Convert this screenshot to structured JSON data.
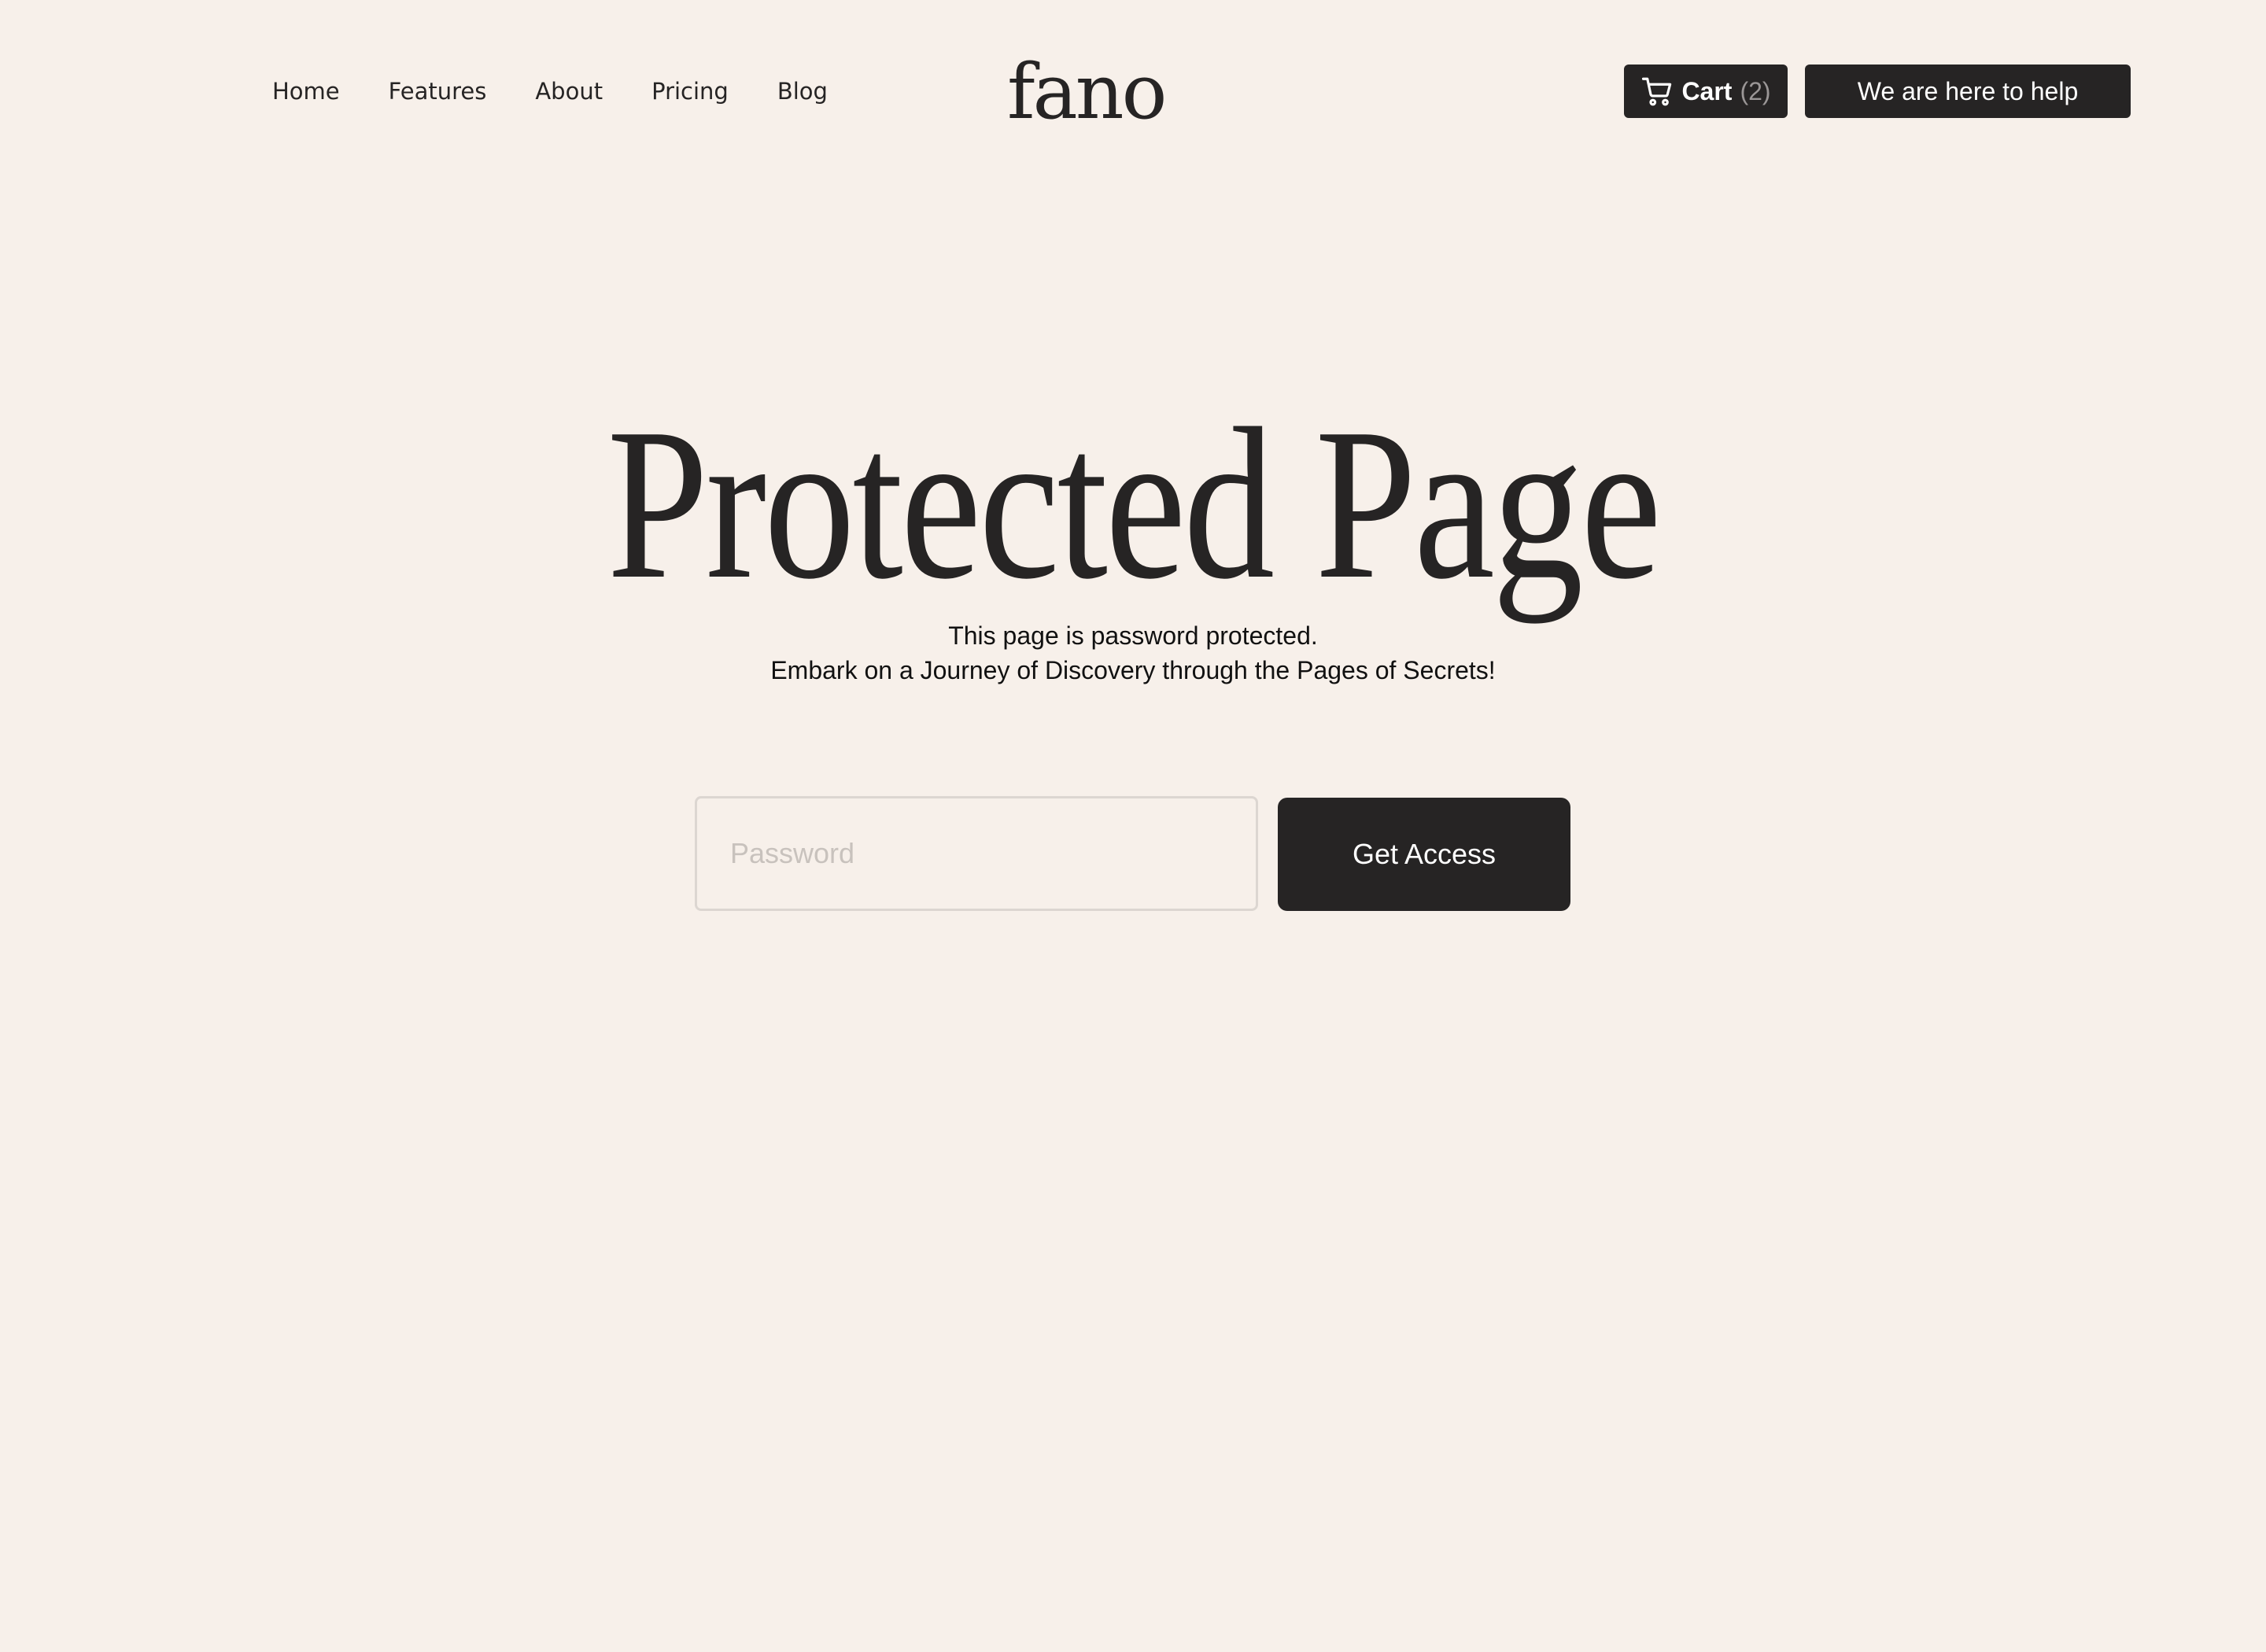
{
  "header": {
    "nav": [
      "Home",
      "Features",
      "About",
      "Pricing",
      "Blog"
    ],
    "logo": "fano",
    "cart": {
      "label": "Cart",
      "count": "(2)",
      "icon": "cart-icon"
    },
    "help_label": "We are here to help"
  },
  "hero": {
    "title": "Protected Page",
    "subtitle_line1": "This page is password protected.",
    "subtitle_line2": "Embark on a Journey of Discovery through the Pages of Secrets!"
  },
  "form": {
    "password_placeholder": "Password",
    "password_value": "",
    "submit_label": "Get Access"
  },
  "colors": {
    "background": "#f7f0ea",
    "primary": "#262424",
    "muted": "#9a9696",
    "input_border": "#dcd6d1"
  }
}
